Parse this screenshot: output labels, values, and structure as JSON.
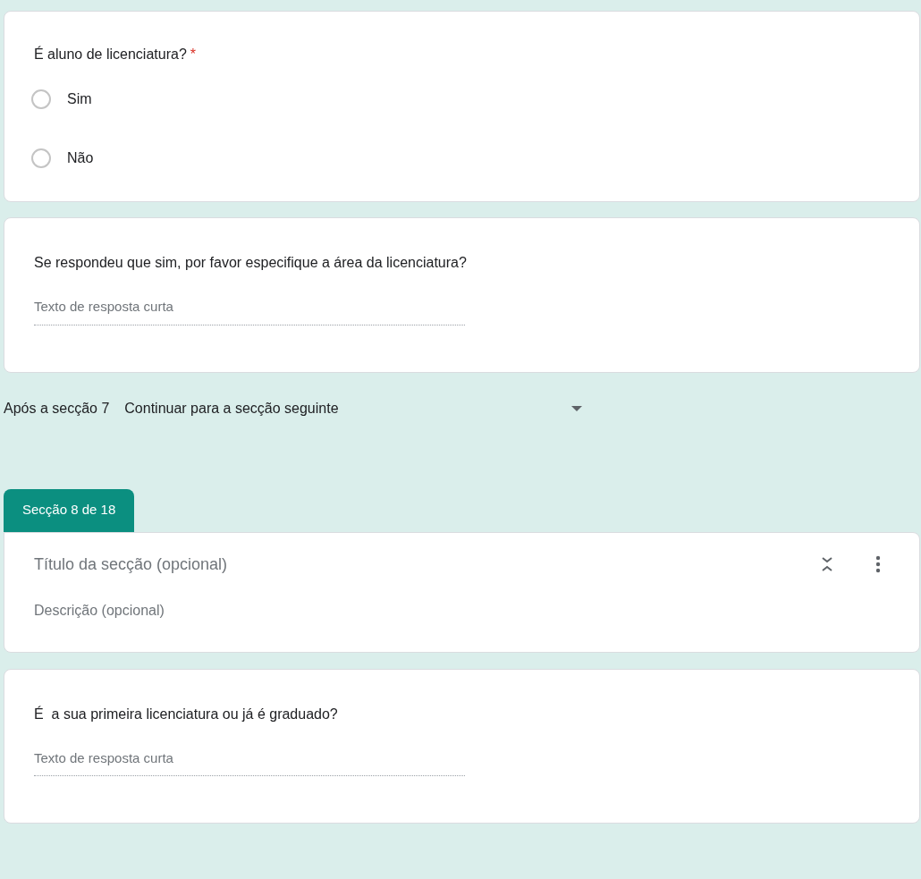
{
  "questions_top": [
    {
      "kind": "radio",
      "title": "É aluno de licenciatura?",
      "required_mark": "*",
      "options": [
        {
          "label": "Sim",
          "selected": false
        },
        {
          "label": "Não",
          "selected": false
        }
      ]
    },
    {
      "kind": "short",
      "title": "Se respondeu que sim, por favor especifique a área da licenciatura?",
      "placeholder": "Texto de resposta curta"
    }
  ],
  "after_section": {
    "label": "Após a secção 7",
    "value": "Continuar para a secção seguinte"
  },
  "section": {
    "tab": "Secção 8 de 18",
    "title_placeholder": "Título da secção (opcional)",
    "description_placeholder": "Descrição (opcional)"
  },
  "questions_bottom": [
    {
      "kind": "short",
      "title": "É  a sua primeira licenciatura ou já é graduado?",
      "placeholder": "Texto de resposta curta"
    }
  ]
}
